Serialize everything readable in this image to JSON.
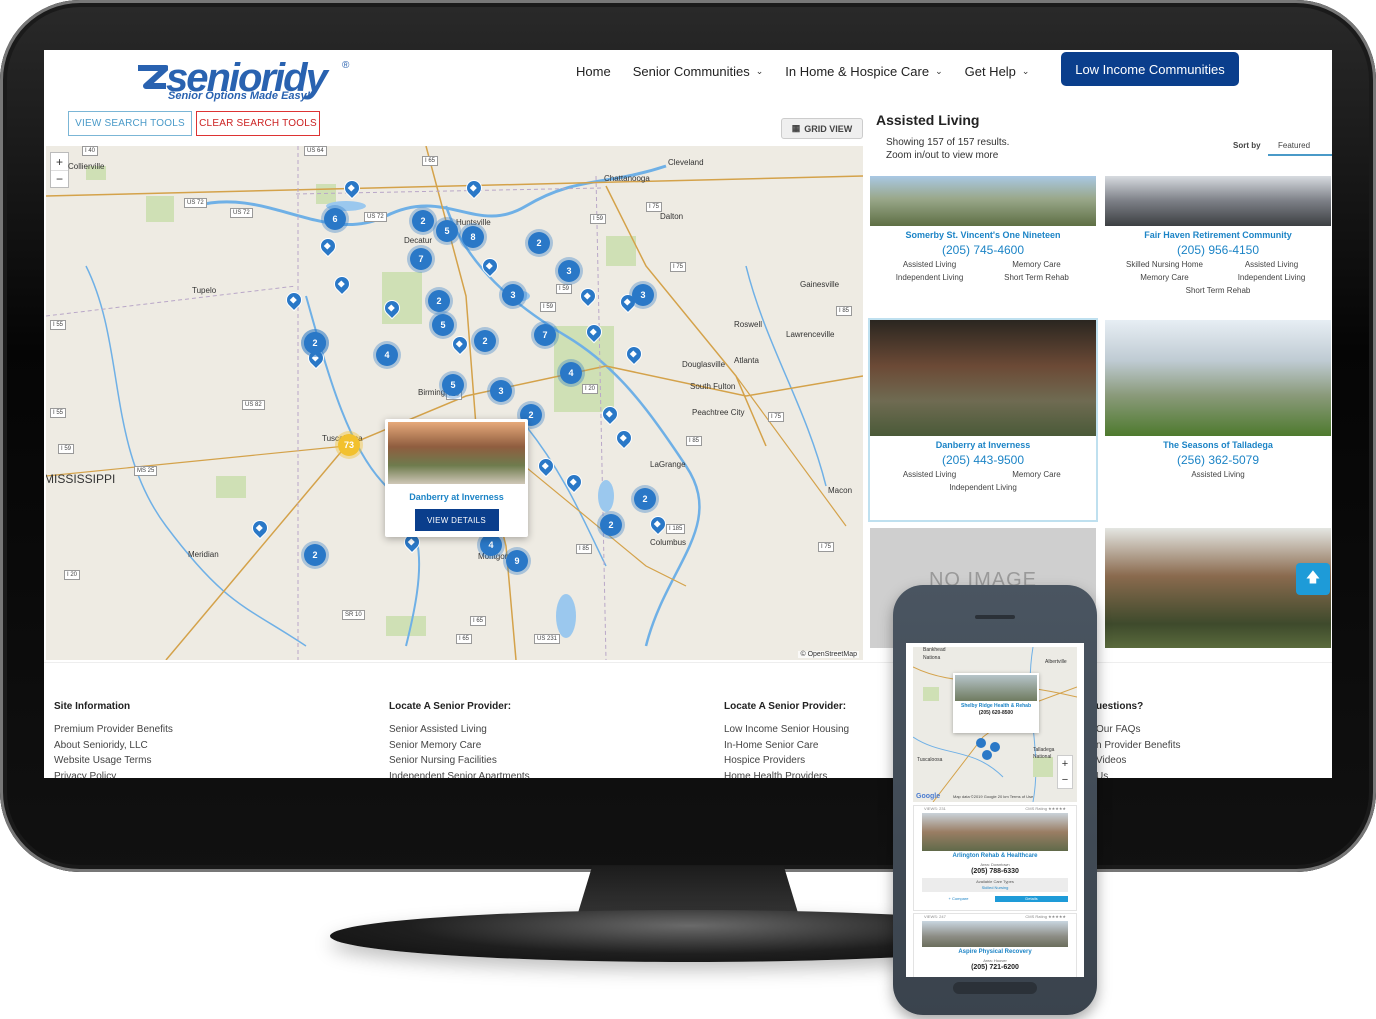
{
  "brand": {
    "name": "senioridy",
    "registered": "®",
    "tagline": "Senior Options Made Easy!",
    "primary_color": "#0a3e8c",
    "accent_color": "#1c84c6"
  },
  "nav": {
    "items": [
      {
        "label": "Home",
        "dropdown": false
      },
      {
        "label": "Senior Communities",
        "dropdown": true
      },
      {
        "label": "In Home & Hospice Care",
        "dropdown": true
      },
      {
        "label": "Get Help",
        "dropdown": true
      }
    ],
    "cta": "Low Income Communities"
  },
  "tools": {
    "view_search": "VIEW SEARCH TOOLS",
    "clear_search": "CLEAR SEARCH TOOLS",
    "grid_view": "GRID VIEW"
  },
  "map": {
    "zoom_in": "+",
    "zoom_out": "−",
    "attribution": "© OpenStreetMap",
    "labels": {
      "collierville": "Collierville",
      "chattanooga": "Chattanooga",
      "cleveland": "Cleveland",
      "dalton": "Dalton",
      "huntsville": "Huntsville",
      "decatur": "Decatur",
      "tupelo": "Tupelo",
      "gainesville": "Gainesville",
      "roswell": "Roswell",
      "lawrenceville": "Lawrenceville",
      "atlanta": "Atlanta",
      "douglasville": "Douglasville",
      "south_fulton": "South Fulton",
      "peachtree_city": "Peachtree City",
      "birmingham": "Birmingham",
      "tuscaloosa": "Tuscaloosa",
      "mississippi": "MISSISSIPPI",
      "lagrange": "LaGrange",
      "macon": "Macon",
      "columbus": "Columbus",
      "meridian": "Meridian",
      "montgomery": "Montgomery"
    },
    "roads": {
      "i40": "I 40",
      "us64": "US 64",
      "i65": "I 65",
      "us72a": "US 72",
      "us72b": "US 72",
      "us72c": "US 72",
      "i59a": "I 59",
      "i75a": "I 75",
      "i75b": "I 75",
      "i59b": "I 59",
      "i55a": "I 55",
      "i59c": "I 59",
      "i85a": "I 85",
      "i20a": "I 20",
      "i20b": "I 20",
      "us82": "US 82",
      "i55b": "I 55",
      "i59d": "I 59",
      "i75c": "I 75",
      "ms25": "MS 25",
      "i85b": "I 85",
      "i185": "I 185",
      "i85c": "I 85",
      "i75d": "I 75",
      "i20c": "I 20",
      "sr10": "SR 10",
      "i65b": "I 65",
      "us231": "US 231",
      "i65c": "I 65"
    },
    "clusters": [
      "2",
      "6",
      "2",
      "5",
      "8",
      "2",
      "7",
      "3",
      "3",
      "3",
      "2",
      "5",
      "2",
      "7",
      "2",
      "4",
      "4",
      "5",
      "3",
      "2",
      "73",
      "2",
      "2",
      "2",
      "4",
      "9"
    ],
    "popup": {
      "name": "Danberry at Inverness",
      "button": "VIEW DETAILS"
    }
  },
  "results": {
    "title": "Assisted Living",
    "count_line1": "Showing 157 of 157 results.",
    "count_line2": "Zoom in/out to view more",
    "sort_label": "Sort by",
    "sort_value": "Featured",
    "cards": [
      {
        "name": "Somerby St. Vincent's One Nineteen",
        "phone": "(205) 745-4600",
        "types": [
          "Assisted Living",
          "Memory Care",
          "Independent Living",
          "Short Term Rehab"
        ]
      },
      {
        "name": "Fair Haven Retirement Community",
        "phone": "(205) 956-4150",
        "types": [
          "Skilled Nursing Home",
          "Assisted Living",
          "Memory Care",
          "Independent Living",
          "Short Term Rehab"
        ]
      },
      {
        "name": "Danberry at Inverness",
        "phone": "(205) 443-9500",
        "types": [
          "Assisted Living",
          "Memory Care",
          "Independent Living"
        ]
      },
      {
        "name": "The Seasons of Talladega",
        "phone": "(256) 362-5079",
        "types": [
          "Assisted Living"
        ]
      },
      {
        "name": "",
        "phone": "",
        "types": [],
        "noimage": "NO IMAGE"
      },
      {
        "name": "",
        "phone": "",
        "types": []
      }
    ]
  },
  "footer": {
    "columns": [
      {
        "heading": "Site Information",
        "links": [
          "Premium Provider Benefits",
          "About Senioridy, LLC",
          "Website Usage Terms",
          "Privacy Policy"
        ]
      },
      {
        "heading": "Locate A Senior Provider:",
        "links": [
          "Senior Assisted Living",
          "Senior Memory Care",
          "Senior Nursing Facilities",
          "Independent Senior Apartments"
        ]
      },
      {
        "heading": "Locate A Senior Provider:",
        "links": [
          "Low Income Senior Housing",
          "In-Home Senior Care",
          "Hospice Providers",
          "Home Health Providers"
        ]
      },
      {
        "heading": "uestions?",
        "links": [
          "Our FAQs",
          "n Provider Benefits",
          "Videos",
          "Us"
        ]
      }
    ]
  },
  "mobile": {
    "map_popup": {
      "name": "Shelby Ridge Health & Rehab",
      "phone": "(205) 620-8500"
    },
    "map_labels": {
      "bankhead": "Bankhead",
      "nationa": "Nationa",
      "tuscaloosa": "Tuscaloosa",
      "talladega": "Talladega",
      "national": "National",
      "albertville": "Albertville"
    },
    "zoom_in": "+",
    "zoom_out": "−",
    "google": "Google",
    "map_data": "Map data ©2019 Google   20 km     Terms of Use",
    "cards": [
      {
        "views": "VIEWS: 231",
        "rating": "CMS Rating ★★★★★",
        "name": "Arlington Rehab & Healthcare",
        "area": "Area: Downtown",
        "phone": "(205) 788-6330",
        "care_label": "Available Care Types",
        "care_value": "Skilled Nursing",
        "compare": "+ Compare",
        "details": "Details"
      },
      {
        "views": "VIEWS: 247",
        "rating": "CMS Rating ★★★★★",
        "name": "Aspire Physical Recovery",
        "area": "Area: Hoover",
        "phone": "(205) 721-6200",
        "care_label": "",
        "care_value": "",
        "compare": "",
        "details": ""
      }
    ]
  }
}
